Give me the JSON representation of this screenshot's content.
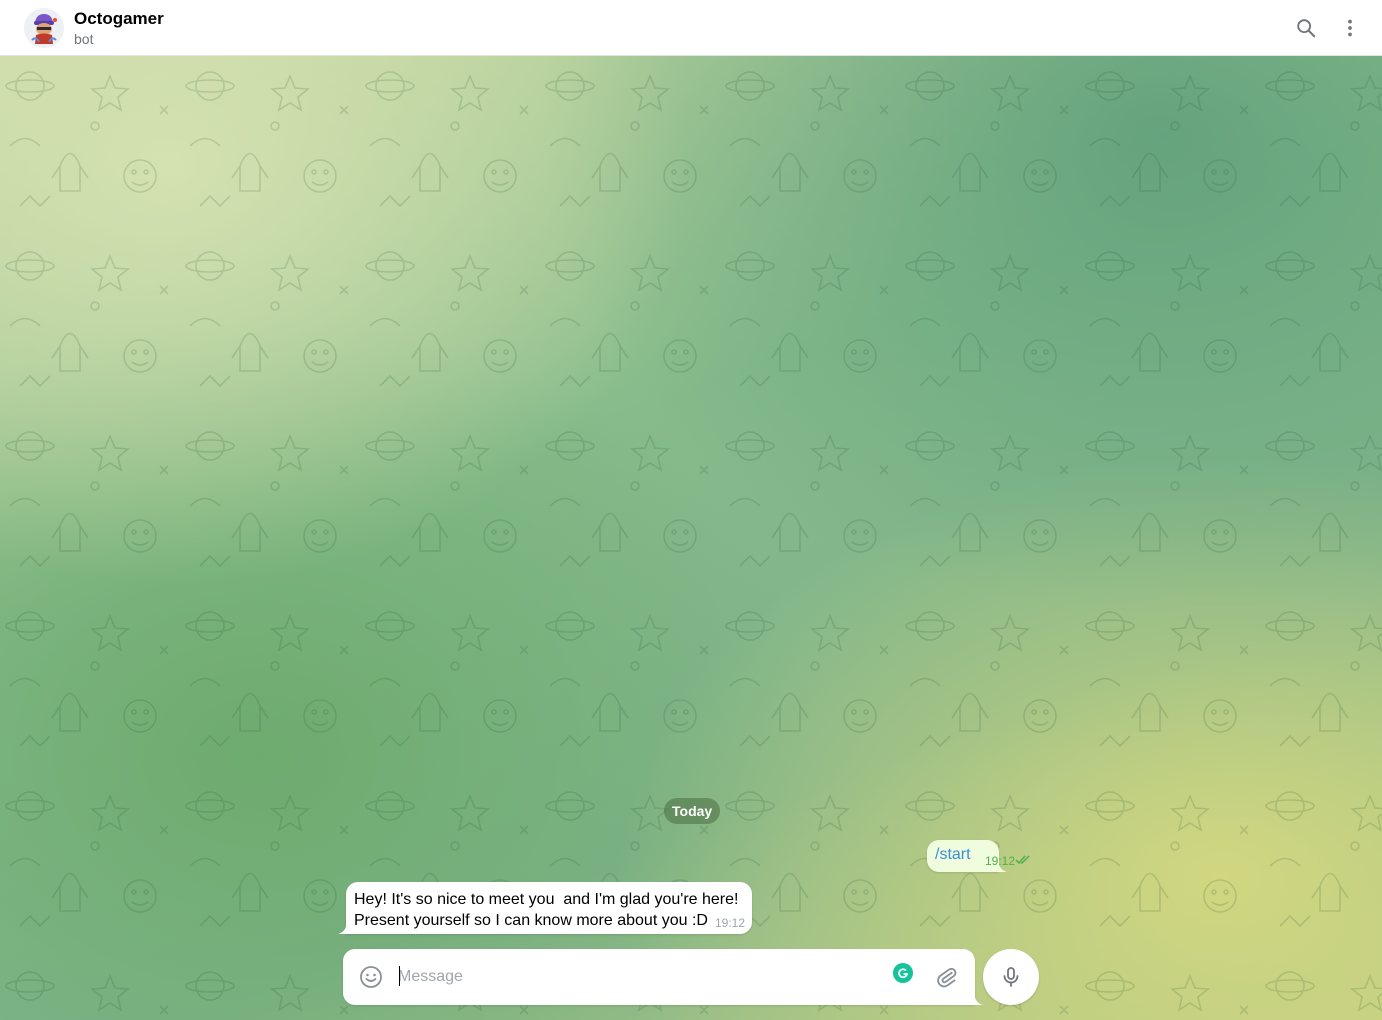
{
  "chat": {
    "title": "Octogamer",
    "subtitle": "bot"
  },
  "header_icons": {
    "search": "search-icon",
    "more": "more-vertical-icon"
  },
  "date_divider": "Today",
  "messages": [
    {
      "direction": "outgoing",
      "text": "/start",
      "time": "19:12",
      "status": "read"
    },
    {
      "direction": "incoming",
      "lines": [
        "Hey! It's so nice to meet you  and I'm glad you're here!",
        "Present yourself so I can know more about you :D"
      ],
      "time": "19:12"
    }
  ],
  "composer": {
    "placeholder": "Message",
    "value": ""
  },
  "colors": {
    "outgoing_bubble": "#effdde",
    "incoming_bubble": "#ffffff",
    "link": "#3a8fd6",
    "read_check": "#4fae4e",
    "grammarly": "#15c39a"
  }
}
